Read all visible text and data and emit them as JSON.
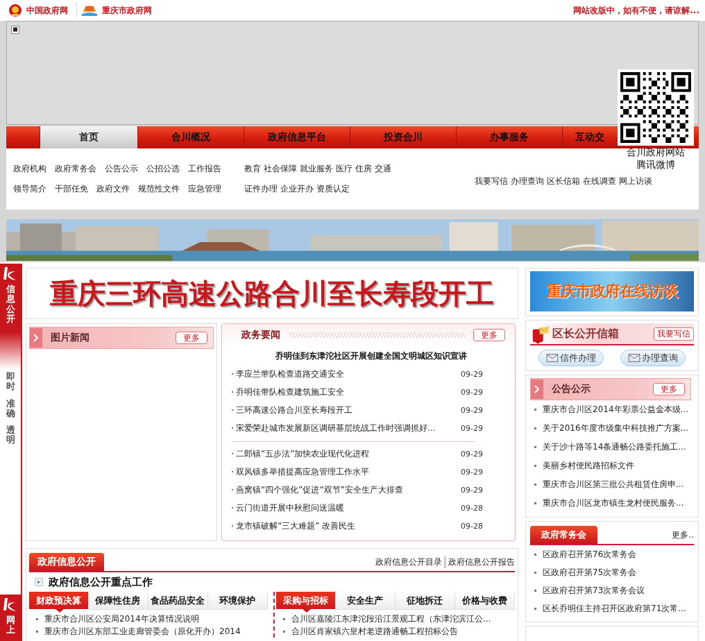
{
  "top_bar": {
    "links": [
      "中国政府网",
      "重庆市政府网"
    ],
    "notice": "网站改版中，如有不便，请谅解..."
  },
  "nav": {
    "tabs": [
      {
        "label": "首页",
        "selected": true
      },
      {
        "label": "合川概况",
        "selected": false
      },
      {
        "label": "政府信息平台",
        "selected": false
      },
      {
        "label": "投资合川",
        "selected": false
      },
      {
        "label": "办事服务",
        "selected": false
      },
      {
        "label": "互动交",
        "selected": false
      }
    ]
  },
  "qr": {
    "captions": [
      "合川政府网站",
      "腾讯微博"
    ]
  },
  "quick_links": {
    "left": [
      [
        "政府机构",
        "政府常务会",
        "公告公示",
        "公招公选",
        "工作报告"
      ],
      [
        "领导简介",
        "干部任免",
        "政府文件",
        "规范性文件",
        "应急管理"
      ]
    ],
    "middle": [
      [
        "教育",
        "社会保障",
        "就业服务",
        "医疗",
        "住房",
        "交通"
      ],
      [
        "证件办理",
        "企业开办",
        "资质认定"
      ]
    ],
    "right": [
      "我要写信",
      "办理查询",
      "区长信箱",
      "在线调查",
      "网上访谈"
    ]
  },
  "side_strip": {
    "title": "信息公开",
    "motto": [
      "即时",
      "准确",
      "透明"
    ],
    "bottom_title": "网上"
  },
  "headline": "重庆三环高速公路合川至长寿段开工",
  "photo_news": {
    "title": "图片新闻",
    "more": "更多"
  },
  "gov_news": {
    "title": "政务要闻",
    "more": "更多",
    "lead": "乔明佳到东津沱社区开展创建全国文明城区知识宣讲",
    "groups": [
      [
        {
          "title": "李应兰带队检查道路交通安全",
          "date": "09-29"
        },
        {
          "title": "乔明佳带队检查建筑施工安全",
          "date": "09-29"
        },
        {
          "title": "三环高速公路合川至长寿段开工",
          "date": "09-29"
        },
        {
          "title": "宋爱荣赴城市发展新区调研基层统战工作时强调抓好...",
          "date": "09-29"
        }
      ],
      [
        {
          "title": "二郎镇“五步法”加快农业现代化进程",
          "date": "09-29"
        },
        {
          "title": "双凤镇多举措提高应急管理工作水平",
          "date": "09-29"
        },
        {
          "title": "燕窝镇“四个强化”促进“双节”安全生产大排查",
          "date": "09-29"
        },
        {
          "title": "云门街道开展中秋慰问送温暖",
          "date": "09-28"
        },
        {
          "title": "龙市镇破解“三大难题” 改善民生",
          "date": "09-28"
        }
      ]
    ]
  },
  "interview_banner": "重庆市政府在线访谈",
  "mailbox": {
    "title": "区长公开信箱",
    "write": "我要写信",
    "buttons": [
      "信件办理",
      "办理查询"
    ]
  },
  "notices": {
    "title": "公告公示",
    "more": "更多",
    "items": [
      "重庆市合川区2014年彩票公益金本级...",
      "关于2016年度市级集中科技推广方案...",
      "关于沙十路等14条通畅公路委托施工...",
      "美丽乡村便民路招标文件",
      "重庆市合川区第三批公共租赁住房申...",
      "重庆市合川区龙市镇生龙村便民服务..."
    ]
  },
  "meetings": {
    "title": "政府常务会",
    "more": "更多..",
    "items": [
      "区政府召开第76次常务会",
      "区政府召开第75次常务会",
      "区政府召开第73次常务会议",
      "区长乔明佳主持召开区政府第71次常..."
    ]
  },
  "info_open": {
    "title": "政府信息公开",
    "links": [
      "政府信息公开目录",
      "政府信息公开报告"
    ],
    "subtitle": "政府信息公开重点工作",
    "groups": [
      {
        "tabs": [
          {
            "label": "财政预决算",
            "selected": true
          },
          {
            "label": "保障性住房",
            "selected": false
          },
          {
            "label": "食品药品安全",
            "selected": false
          },
          {
            "label": "环境保护",
            "selected": false
          }
        ],
        "items": [
          "重庆市合川区公安局2014年决算情况说明",
          "重庆市合川区东部工业走廊管委会（原化开办）2014"
        ]
      },
      {
        "tabs": [
          {
            "label": "采购与招标",
            "selected": true
          },
          {
            "label": "安全生产",
            "selected": false
          },
          {
            "label": "征地拆迁",
            "selected": false
          },
          {
            "label": "价格与收费",
            "selected": false
          }
        ],
        "items": [
          "合川区嘉陵江东津沱段沿江景观工程（东津沱滨江公...",
          "合川区肖家镇六皇村老逆路通畅工程招标公告"
        ]
      }
    ]
  }
}
